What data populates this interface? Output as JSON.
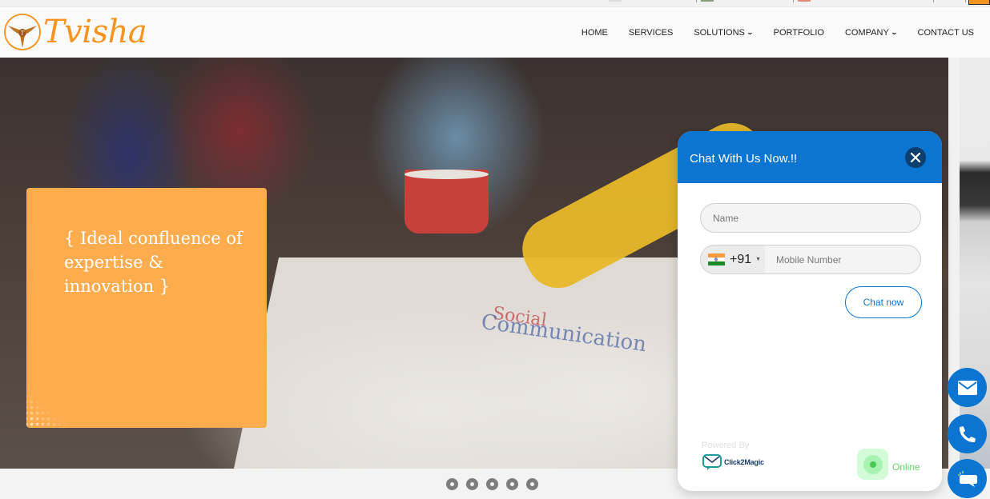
{
  "brand": {
    "name": "Tvisha",
    "color": "#f7931e"
  },
  "nav": {
    "items": [
      {
        "label": "HOME",
        "has_dropdown": false
      },
      {
        "label": "SERVICES",
        "has_dropdown": false
      },
      {
        "label": "SOLUTIONS",
        "has_dropdown": true
      },
      {
        "label": "PORTFOLIO",
        "has_dropdown": false
      },
      {
        "label": "COMPANY",
        "has_dropdown": true
      },
      {
        "label": "CONTACT US",
        "has_dropdown": false
      }
    ],
    "dropdown_glyph": "❯"
  },
  "hero": {
    "slide_text": "{ Ideal confluence of expertise & innovation }",
    "card_color": "#ffac4f",
    "image_doodle_1": "Social",
    "image_doodle_2": "Communication",
    "slide_count": 5
  },
  "chat": {
    "title": "Chat With Us Now.!!",
    "header_color": "#0b75d1",
    "close_icon": "close-icon",
    "name_placeholder": "Name",
    "name_value": "",
    "country_flag": "India",
    "dial_code": "+91",
    "mobile_placeholder": "Mobile Number",
    "mobile_value": "",
    "submit_label": "Chat now",
    "powered_by": "Powered By",
    "provider": "Click2Magic",
    "status": "Online",
    "status_color": "#6ad36a"
  },
  "floating_actions": [
    {
      "icon": "mail-icon",
      "label": "Email"
    },
    {
      "icon": "phone-icon",
      "label": "Call"
    },
    {
      "icon": "chat-bubble-icon",
      "label": "Chat"
    }
  ]
}
